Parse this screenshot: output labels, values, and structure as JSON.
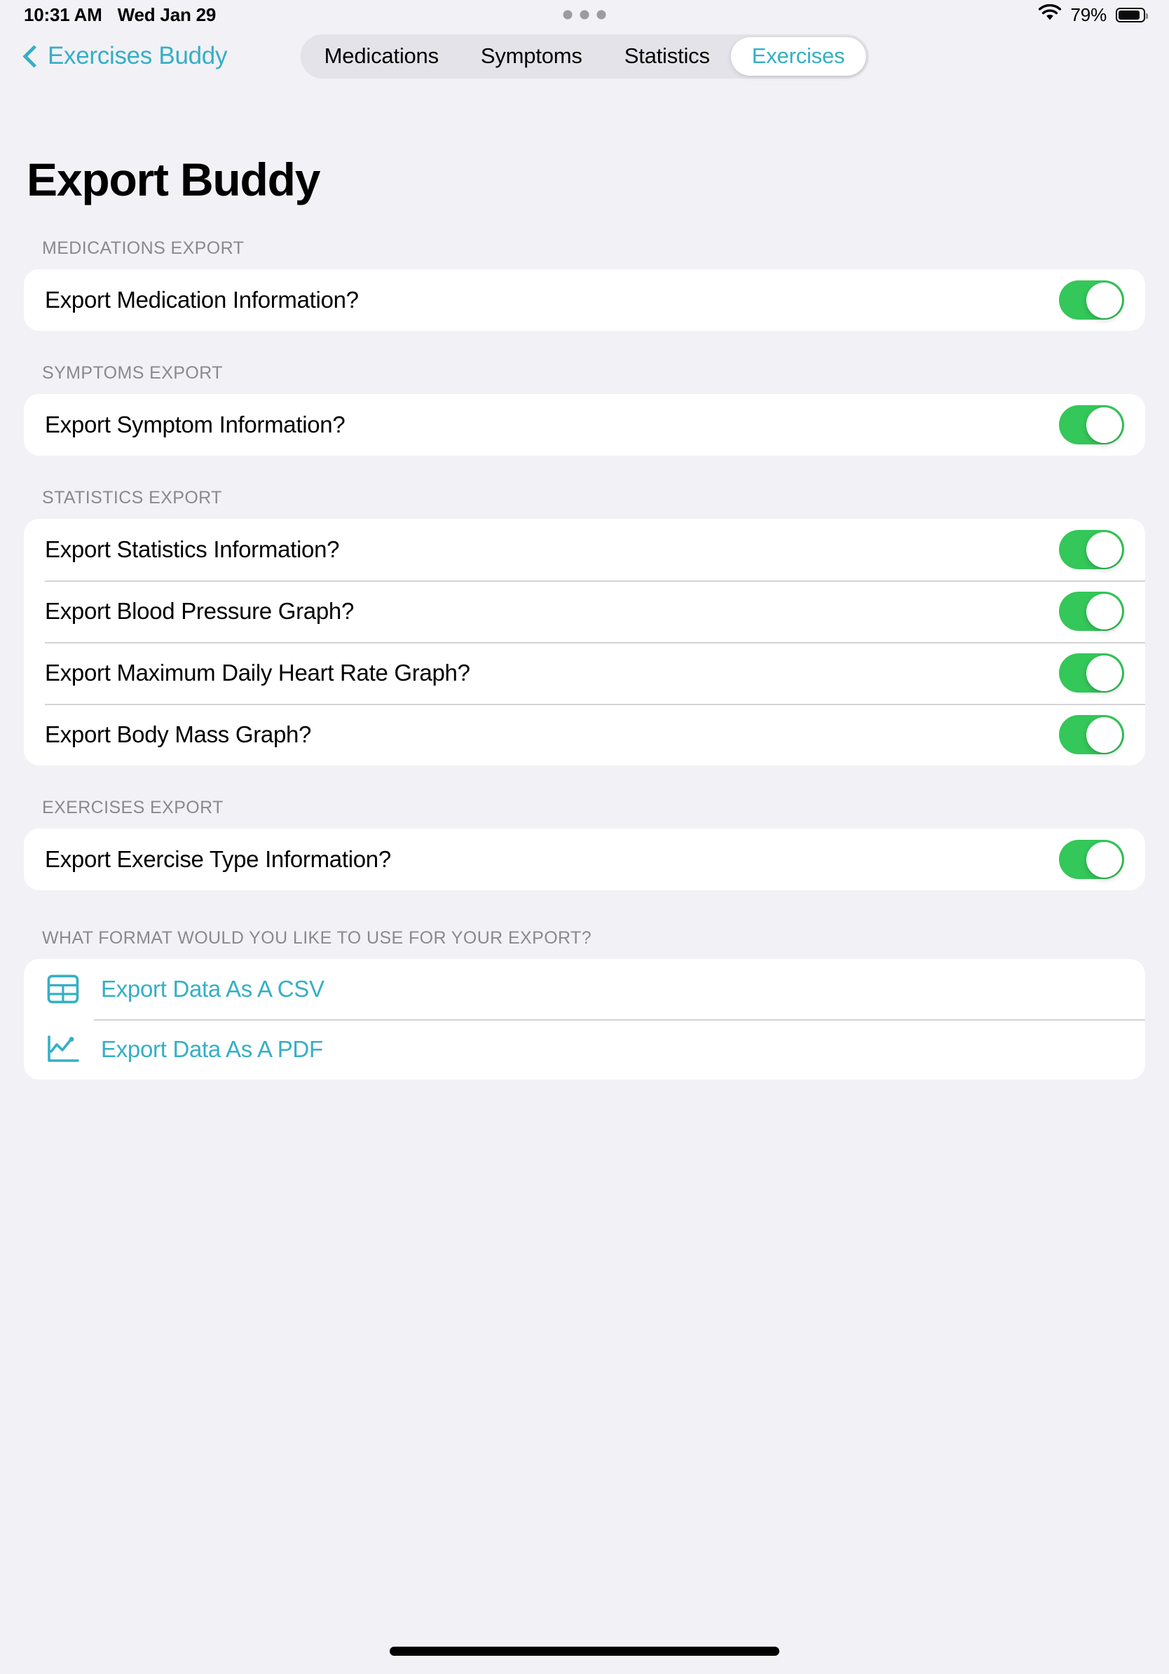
{
  "status_bar": {
    "time": "10:31 AM",
    "date": "Wed Jan 29",
    "battery_percent": "79%",
    "wifi_icon": "wifi-icon",
    "battery_icon": "battery-icon",
    "multitask_icon": "multitasking-dots-icon"
  },
  "nav": {
    "back_label": "Exercises Buddy",
    "back_icon": "chevron-left-icon",
    "tabs": [
      {
        "label": "Medications",
        "selected": false
      },
      {
        "label": "Symptoms",
        "selected": false
      },
      {
        "label": "Statistics",
        "selected": false
      },
      {
        "label": "Exercises",
        "selected": true
      }
    ]
  },
  "page": {
    "title": "Export Buddy"
  },
  "sections": [
    {
      "header": "MEDICATIONS EXPORT",
      "rows": [
        {
          "label": "Export Medication Information?",
          "toggle": "on"
        }
      ]
    },
    {
      "header": "SYMPTOMS EXPORT",
      "rows": [
        {
          "label": "Export Symptom Information?",
          "toggle": "on"
        }
      ]
    },
    {
      "header": "STATISTICS EXPORT",
      "rows": [
        {
          "label": "Export Statistics Information?",
          "toggle": "on"
        },
        {
          "label": "Export Blood Pressure Graph?",
          "toggle": "on"
        },
        {
          "label": "Export Maximum Daily Heart Rate Graph?",
          "toggle": "on"
        },
        {
          "label": "Export Body Mass Graph?",
          "toggle": "on"
        }
      ]
    },
    {
      "header": "EXERCISES EXPORT",
      "rows": [
        {
          "label": "Export Exercise Type Information?",
          "toggle": "on"
        }
      ]
    }
  ],
  "format_section": {
    "header": "WHAT FORMAT WOULD YOU LIKE TO USE FOR YOUR EXPORT?",
    "options": [
      {
        "label": "Export Data As A CSV",
        "icon": "table-grid-icon"
      },
      {
        "label": "Export Data As A PDF",
        "icon": "line-chart-icon"
      }
    ]
  },
  "colors": {
    "accent_teal": "#35AFC5",
    "toggle_green": "#34C759",
    "background": "#F2F1F6",
    "card": "#FFFFFF",
    "section_header_grey": "#8A8A8E"
  }
}
